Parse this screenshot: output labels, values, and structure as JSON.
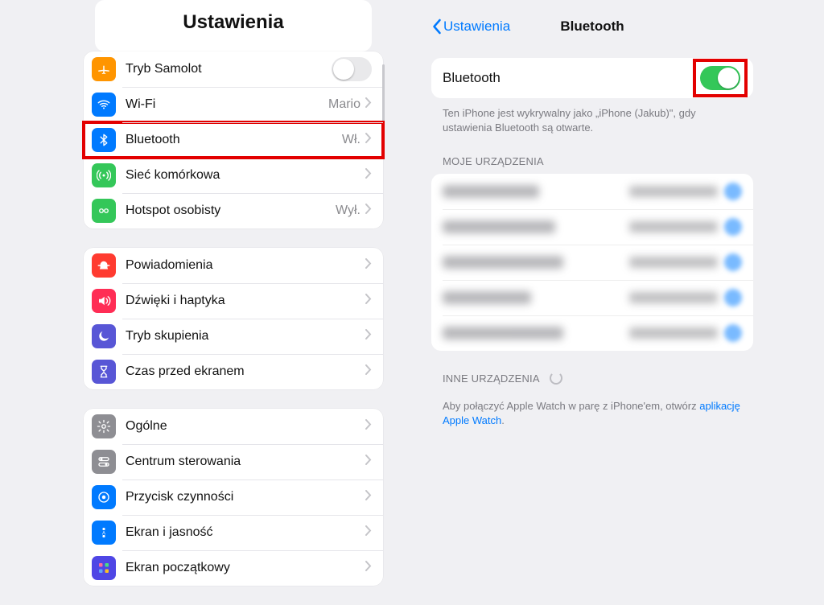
{
  "left": {
    "title": "Ustawienia",
    "groups": [
      [
        {
          "icon": "airplane",
          "color": "#ff9500",
          "label": "Tryb Samolot",
          "valueType": "switchOff"
        },
        {
          "icon": "wifi",
          "color": "#007aff",
          "label": "Wi-Fi",
          "value": "Mario",
          "chevron": true
        },
        {
          "icon": "bluetooth",
          "color": "#007aff",
          "label": "Bluetooth",
          "value": "Wł.",
          "chevron": true,
          "highlight": true
        },
        {
          "icon": "cellular",
          "color": "#34c759",
          "label": "Sieć komórkowa",
          "chevron": true
        },
        {
          "icon": "hotspot",
          "color": "#34c759",
          "label": "Hotspot osobisty",
          "value": "Wył.",
          "chevron": true
        }
      ],
      [
        {
          "icon": "bell",
          "color": "#ff3b30",
          "label": "Powiadomienia",
          "chevron": true
        },
        {
          "icon": "speaker",
          "color": "#ff2d55",
          "label": "Dźwięki i haptyka",
          "chevron": true
        },
        {
          "icon": "moon",
          "color": "#5856d6",
          "label": "Tryb skupienia",
          "chevron": true
        },
        {
          "icon": "hourglass",
          "color": "#5856d6",
          "label": "Czas przed ekranem",
          "chevron": true
        }
      ],
      [
        {
          "icon": "gear",
          "color": "#8e8e93",
          "label": "Ogólne",
          "chevron": true
        },
        {
          "icon": "toggles",
          "color": "#8e8e93",
          "label": "Centrum sterowania",
          "chevron": true
        },
        {
          "icon": "action",
          "color": "#007aff",
          "label": "Przycisk czynności",
          "chevron": true
        },
        {
          "icon": "sun",
          "color": "#007aff",
          "label": "Ekran i jasność",
          "chevron": true
        },
        {
          "icon": "grid",
          "color": "#4f46e5",
          "label": "Ekran początkowy",
          "chevron": true
        }
      ]
    ]
  },
  "right": {
    "back": "Ustawienia",
    "title": "Bluetooth",
    "toggleLabel": "Bluetooth",
    "toggleOn": true,
    "discoverableText": "Ten iPhone jest wykrywalny jako „iPhone (Jakub)\", gdy ustawienia Bluetooth są otwarte.",
    "myDevicesTitle": "MOJE URZĄDZENIA",
    "devices": [
      {
        "nameW": 120,
        "statusW": 110
      },
      {
        "nameW": 140,
        "statusW": 110
      },
      {
        "nameW": 150,
        "statusW": 110
      },
      {
        "nameW": 110,
        "statusW": 110
      },
      {
        "nameW": 150,
        "statusW": 110
      }
    ],
    "otherDevicesTitle": "INNE URZĄDZENIA",
    "watchText1": "Aby połączyć Apple Watch w parę z iPhone'em, otwórz ",
    "watchLink": "aplikację Apple Watch",
    "watchText2": "."
  },
  "icons": {
    "airplane": "airplane-icon",
    "wifi": "wifi-icon",
    "bluetooth": "bluetooth-icon",
    "cellular": "cellular-icon",
    "hotspot": "hotspot-icon",
    "bell": "bell-icon",
    "speaker": "speaker-icon",
    "moon": "moon-icon",
    "hourglass": "hourglass-icon",
    "gear": "gear-icon",
    "toggles": "toggles-icon",
    "action": "action-icon",
    "sun": "sun-icon",
    "grid": "grid-icon"
  }
}
